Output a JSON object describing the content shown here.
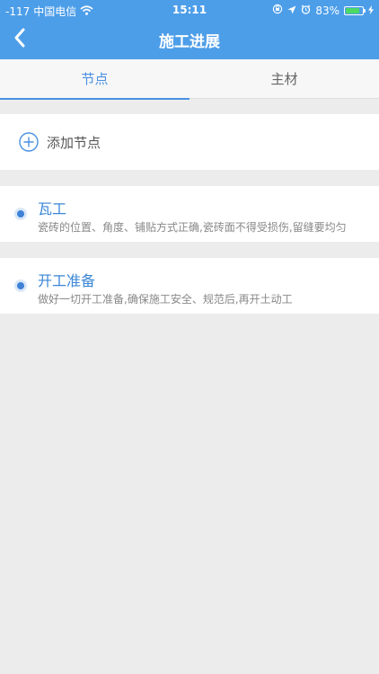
{
  "status_bar": {
    "signal": "-117",
    "carrier": "中国电信",
    "time": "15:11",
    "battery_percent": "83%",
    "battery_level": 0.83,
    "battery_color": "#4cd964"
  },
  "nav": {
    "title": "施工进展",
    "back_icon": "chevron-left-icon"
  },
  "tabs": [
    {
      "label": "节点",
      "active": true
    },
    {
      "label": "主材",
      "active": false
    }
  ],
  "add_node": {
    "label": "添加节点",
    "icon": "plus-circle-icon"
  },
  "nodes": [
    {
      "title": "瓦工",
      "desc": "瓷砖的位置、角度、铺贴方式正确,瓷砖面不得受损伤,留缝要均匀"
    },
    {
      "title": "开工准备",
      "desc": "做好一切开工准备,确保施工安全、规范后,再开土动工"
    }
  ],
  "colors": {
    "header_bg": "#4d9ee9",
    "accent": "#4a90e2",
    "page_bg": "#ececec"
  }
}
